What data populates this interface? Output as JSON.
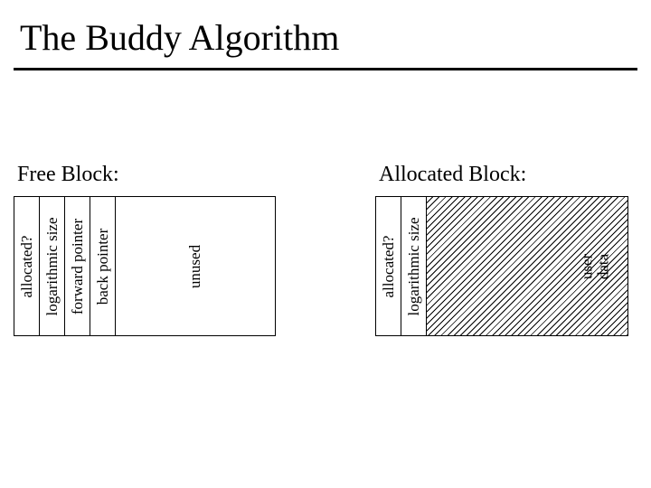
{
  "title": "The Buddy Algorithm",
  "free": {
    "label": "Free Block:",
    "cells": [
      "allocated?",
      "logarithmic size",
      "forward pointer",
      "back pointer"
    ],
    "unused": "unused"
  },
  "alloc": {
    "label": "Allocated Block:",
    "cells": [
      "allocated?",
      "logarithmic size"
    ],
    "user1": "user",
    "user2": "data"
  }
}
